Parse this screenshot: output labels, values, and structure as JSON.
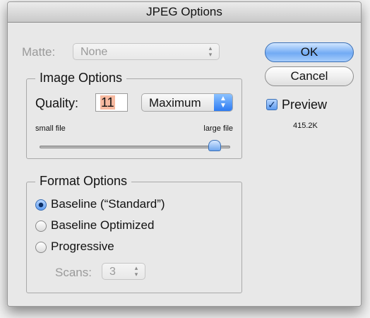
{
  "window": {
    "title": "JPEG Options"
  },
  "matte": {
    "label": "Matte:",
    "value": "None"
  },
  "image_options": {
    "title": "Image Options",
    "quality_label": "Quality:",
    "quality_value": "11",
    "preset_value": "Maximum",
    "slider": {
      "min_label": "small file",
      "max_label": "large file",
      "level": 11,
      "max": 12
    }
  },
  "format_options": {
    "title": "Format Options",
    "options": [
      "Baseline (“Standard”)",
      "Baseline Optimized",
      "Progressive"
    ],
    "selected_index": 0,
    "scans_label": "Scans:",
    "scans_value": "3"
  },
  "buttons": {
    "ok": "OK",
    "cancel": "Cancel"
  },
  "preview": {
    "label": "Preview",
    "checked": true,
    "size": "415.2K"
  },
  "colors": {
    "accent": "#5e9cf1",
    "selection": "#f6b9a0"
  }
}
